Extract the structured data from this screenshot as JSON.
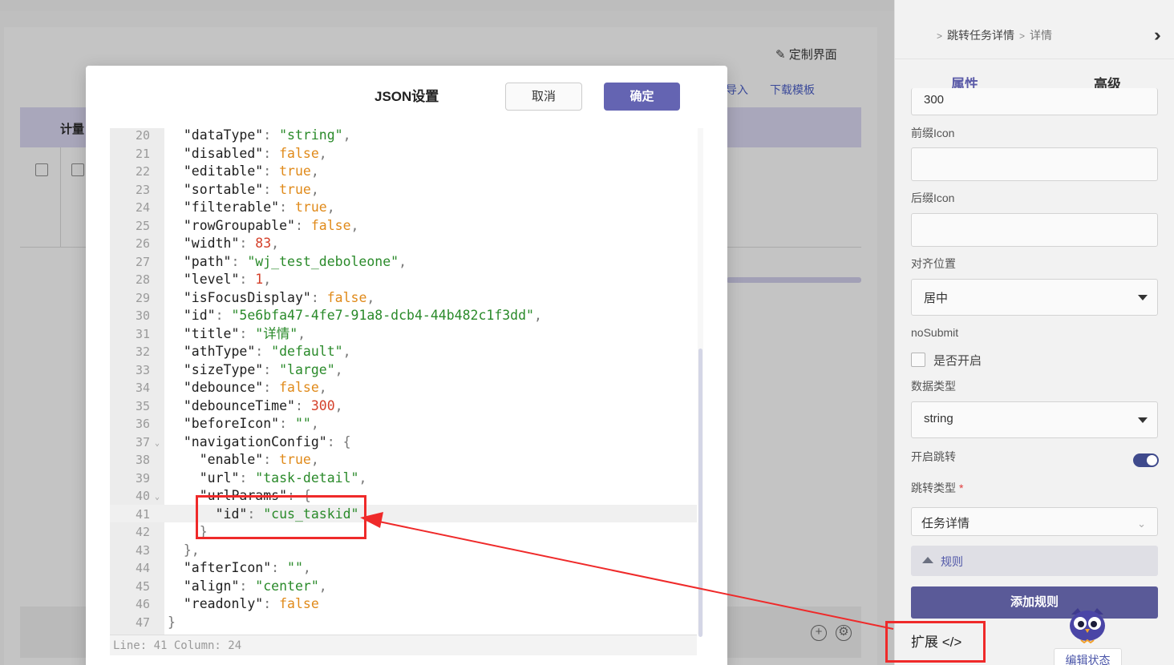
{
  "background": {
    "customize_label": "定制界面",
    "import_link": "导入",
    "download_link": "下载模板",
    "table_header": "计量"
  },
  "panel": {
    "breadcrumb": [
      "跳转任务详情",
      "详情"
    ],
    "tabs": [
      "属性",
      "高级"
    ],
    "debounce_value": "300",
    "prefix_icon_label": "前缀Icon",
    "prefix_icon_value": "",
    "suffix_icon_label": "后缀Icon",
    "suffix_icon_value": "",
    "align_label": "对齐位置",
    "align_value": "居中",
    "nosubmit_label": "noSubmit",
    "nosubmit_checkbox_label": "是否开启",
    "data_type_label": "数据类型",
    "data_type_value": "string",
    "enable_nav_label": "开启跳转",
    "nav_type_label": "跳转类型",
    "nav_type_required": "*",
    "nav_type_value": "任务详情",
    "rules_label": "规则",
    "add_rule_label": "添加规则",
    "extend_label": "扩展 </>",
    "edit_state_label": "编辑状态"
  },
  "modal": {
    "title": "JSON设置",
    "cancel_label": "取消",
    "ok_label": "确定",
    "status": "Line: 41  Column: 24",
    "lines": [
      {
        "n": 20,
        "indent": 1,
        "key": "dataType",
        "val": "string",
        "type": "s",
        "comma": true
      },
      {
        "n": 21,
        "indent": 1,
        "key": "disabled",
        "val": "false",
        "type": "b",
        "comma": true
      },
      {
        "n": 22,
        "indent": 1,
        "key": "editable",
        "val": "true",
        "type": "b",
        "comma": true
      },
      {
        "n": 23,
        "indent": 1,
        "key": "sortable",
        "val": "true",
        "type": "b",
        "comma": true
      },
      {
        "n": 24,
        "indent": 1,
        "key": "filterable",
        "val": "true",
        "type": "b",
        "comma": true
      },
      {
        "n": 25,
        "indent": 1,
        "key": "rowGroupable",
        "val": "false",
        "type": "b",
        "comma": true
      },
      {
        "n": 26,
        "indent": 1,
        "key": "width",
        "val": "83",
        "type": "n",
        "comma": true
      },
      {
        "n": 27,
        "indent": 1,
        "key": "path",
        "val": "wj_test_deboleone",
        "type": "s",
        "comma": true
      },
      {
        "n": 28,
        "indent": 1,
        "key": "level",
        "val": "1",
        "type": "n",
        "comma": true
      },
      {
        "n": 29,
        "indent": 1,
        "key": "isFocusDisplay",
        "val": "false",
        "type": "b",
        "comma": true
      },
      {
        "n": 30,
        "indent": 1,
        "key": "id",
        "val": "5e6bfa47-4fe7-91a8-dcb4-44b482c1f3dd",
        "type": "s",
        "comma": true
      },
      {
        "n": 31,
        "indent": 1,
        "key": "title",
        "val": "详情",
        "type": "s",
        "comma": true
      },
      {
        "n": 32,
        "indent": 1,
        "key": "athType",
        "val": "default",
        "type": "s",
        "comma": true
      },
      {
        "n": 33,
        "indent": 1,
        "key": "sizeType",
        "val": "large",
        "type": "s",
        "comma": true
      },
      {
        "n": 34,
        "indent": 1,
        "key": "debounce",
        "val": "false",
        "type": "b",
        "comma": true
      },
      {
        "n": 35,
        "indent": 1,
        "key": "debounceTime",
        "val": "300",
        "type": "n",
        "comma": true
      },
      {
        "n": 36,
        "indent": 1,
        "key": "beforeIcon",
        "val": "",
        "type": "s",
        "comma": true
      },
      {
        "n": 37,
        "indent": 1,
        "key": "navigationConfig",
        "open": "{",
        "fold": true
      },
      {
        "n": 38,
        "indent": 2,
        "key": "enable",
        "val": "true",
        "type": "b",
        "comma": true
      },
      {
        "n": 39,
        "indent": 2,
        "key": "url",
        "val": "task-detail",
        "type": "s",
        "comma": true
      },
      {
        "n": 40,
        "indent": 2,
        "key": "urlParams",
        "open": "{",
        "fold": true
      },
      {
        "n": 41,
        "indent": 3,
        "key": "id",
        "val": "cus_taskid",
        "type": "s",
        "comma": false
      },
      {
        "n": 42,
        "indent": 2,
        "close": "}"
      },
      {
        "n": 43,
        "indent": 1,
        "close": "},"
      },
      {
        "n": 44,
        "indent": 1,
        "key": "afterIcon",
        "val": "",
        "type": "s",
        "comma": true
      },
      {
        "n": 45,
        "indent": 1,
        "key": "align",
        "val": "center",
        "type": "s",
        "comma": true
      },
      {
        "n": 46,
        "indent": 1,
        "key": "readonly",
        "val": "false",
        "type": "b",
        "comma": false
      },
      {
        "n": 47,
        "indent": 0,
        "close": "}"
      }
    ]
  },
  "colors": {
    "accent": "#6464b2",
    "annotation_red": "#ef2a2a",
    "json_string": "#2a8a2a",
    "json_number": "#d4402a",
    "json_boolean": "#e08a1a"
  }
}
